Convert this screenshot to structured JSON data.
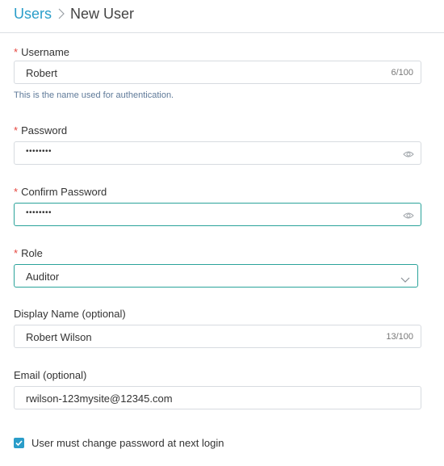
{
  "breadcrumb": {
    "parent": "Users",
    "current": "New User"
  },
  "form": {
    "username": {
      "label": "Username",
      "required_marker": "*",
      "value": "Robert",
      "counter": "6/100",
      "hint": "This is the name used for authentication."
    },
    "password": {
      "label": "Password",
      "required_marker": "*",
      "masked_value": "••••••••"
    },
    "confirm_password": {
      "label": "Confirm Password",
      "required_marker": "*",
      "masked_value": "••••••••"
    },
    "role": {
      "label": "Role",
      "required_marker": "*",
      "selected": "Auditor"
    },
    "display_name": {
      "label": "Display Name (optional)",
      "value": "Robert Wilson",
      "counter": "13/100"
    },
    "email": {
      "label": "Email (optional)",
      "value": "rwilson-123mysite@12345.com"
    },
    "change_password_checkbox": {
      "label": "User must change password at next login",
      "checked": true
    }
  },
  "colors": {
    "accent": "#2a9dc9",
    "focus_border": "#2aa39a",
    "required": "#e5463f",
    "hint": "#5f7a99"
  },
  "icons": {
    "breadcrumb_separator": "chevron-right-icon",
    "password_toggle": "eye-icon",
    "select_arrow": "chevron-down-icon",
    "checkbox": "checkmark-icon"
  }
}
